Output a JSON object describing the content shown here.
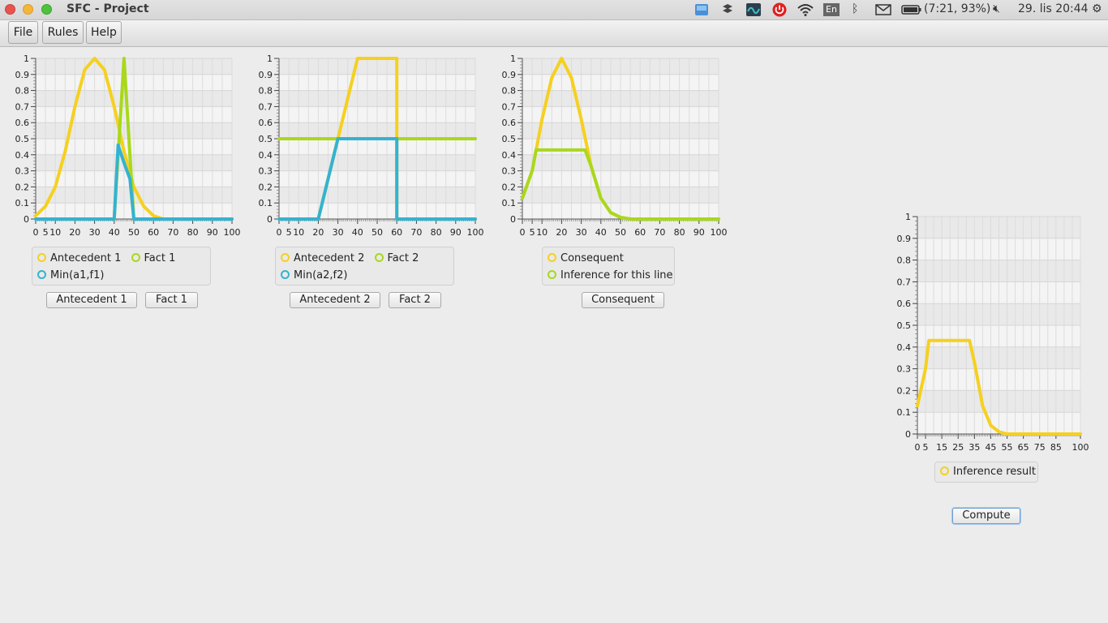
{
  "window": {
    "title": "SFC - Project"
  },
  "tray": {
    "battery": "(7:21, 93%)",
    "keyboard": "En",
    "datetime": "29. lis 20:44",
    "icons": [
      "dropbox-icon",
      "network-indicator-icon",
      "power-icon",
      "wifi-icon",
      "keyboard-layout-icon",
      "bluetooth-icon",
      "mail-icon",
      "battery-icon",
      "volume-muted-icon",
      "settings-gear-icon"
    ]
  },
  "menu": {
    "file": "File",
    "rules": "Rules",
    "help": "Help"
  },
  "colors": {
    "yellow": "#f5d020",
    "green": "#a9d81c",
    "blue": "#34b3d0"
  },
  "charts": {
    "c1": {
      "legend_line1": [
        "Antecedent 1",
        "Fact 1"
      ],
      "legend_line2": [
        "Min(a1,f1)"
      ],
      "buttons": [
        "Antecedent 1",
        "Fact 1"
      ]
    },
    "c2": {
      "legend_line1": [
        "Antecedent 2",
        "Fact 2"
      ],
      "legend_line2": [
        "Min(a2,f2)"
      ],
      "buttons": [
        "Antecedent 2",
        "Fact 2"
      ]
    },
    "c3": {
      "legend_line1": [
        "Consequent"
      ],
      "legend_line2": [
        "Inference for this line"
      ],
      "buttons": [
        "Consequent"
      ]
    },
    "c4": {
      "legend_line1": [
        "Inference result"
      ],
      "buttons": [
        "Compute"
      ]
    }
  },
  "chart_data": [
    {
      "type": "line",
      "xlim": [
        0,
        100
      ],
      "ylim": [
        0,
        1
      ],
      "xticks": [
        "0",
        "5",
        "10",
        "20",
        "30",
        "40",
        "50",
        "60",
        "70",
        "80",
        "90",
        "100"
      ],
      "yticks": [
        "0",
        "0.1",
        "0.2",
        "0.3",
        "0.4",
        "0.5",
        "0.6",
        "0.7",
        "0.8",
        "0.9",
        "1"
      ],
      "series": [
        {
          "name": "Antecedent 1",
          "color": "yellow",
          "x": [
            0,
            5,
            10,
            15,
            20,
            25,
            30,
            35,
            40,
            45,
            50,
            55,
            60,
            65,
            70,
            100
          ],
          "y": [
            0.02,
            0.08,
            0.2,
            0.42,
            0.7,
            0.93,
            1.0,
            0.93,
            0.7,
            0.42,
            0.2,
            0.08,
            0.02,
            0.0,
            0.0,
            0.0
          ]
        },
        {
          "name": "Fact 1",
          "color": "green",
          "x": [
            0,
            40,
            45,
            50,
            100
          ],
          "y": [
            0,
            0,
            1,
            0,
            0
          ]
        },
        {
          "name": "Min(a1,f1)",
          "color": "blue",
          "x": [
            0,
            40,
            42,
            45,
            48,
            50,
            100
          ],
          "y": [
            0,
            0,
            0.46,
            0.35,
            0.25,
            0,
            0
          ]
        }
      ]
    },
    {
      "type": "line",
      "xlim": [
        0,
        100
      ],
      "ylim": [
        0,
        1
      ],
      "xticks": [
        "0",
        "5",
        "10",
        "20",
        "30",
        "40",
        "50",
        "60",
        "70",
        "80",
        "90",
        "100"
      ],
      "yticks": [
        "0",
        "0.1",
        "0.2",
        "0.3",
        "0.4",
        "0.5",
        "0.6",
        "0.7",
        "0.8",
        "0.9",
        "1"
      ],
      "series": [
        {
          "name": "Antecedent 2",
          "color": "yellow",
          "x": [
            0,
            20,
            40,
            60,
            60,
            100
          ],
          "y": [
            0,
            0,
            1,
            1,
            0,
            0
          ]
        },
        {
          "name": "Fact 2",
          "color": "green",
          "x": [
            0,
            100
          ],
          "y": [
            0.5,
            0.5
          ]
        },
        {
          "name": "Min(a2,f2)",
          "color": "blue",
          "x": [
            0,
            20,
            30,
            60,
            60,
            100
          ],
          "y": [
            0,
            0,
            0.5,
            0.5,
            0,
            0
          ]
        }
      ]
    },
    {
      "type": "line",
      "xlim": [
        0,
        100
      ],
      "ylim": [
        0,
        1
      ],
      "xticks": [
        "0",
        "5",
        "10",
        "20",
        "30",
        "40",
        "50",
        "60",
        "70",
        "80",
        "90",
        "100"
      ],
      "yticks": [
        "0",
        "0.1",
        "0.2",
        "0.3",
        "0.4",
        "0.5",
        "0.6",
        "0.7",
        "0.8",
        "0.9",
        "1"
      ],
      "series": [
        {
          "name": "Consequent",
          "color": "yellow",
          "x": [
            0,
            5,
            10,
            15,
            20,
            25,
            30,
            35,
            40,
            45,
            50,
            55,
            60,
            100
          ],
          "y": [
            0.13,
            0.3,
            0.62,
            0.88,
            1.0,
            0.88,
            0.62,
            0.33,
            0.13,
            0.04,
            0.01,
            0.0,
            0.0,
            0.0
          ]
        },
        {
          "name": "Inference for this line",
          "color": "green",
          "x": [
            0,
            5,
            7,
            32,
            35,
            40,
            45,
            50,
            55,
            60,
            100
          ],
          "y": [
            0.13,
            0.3,
            0.43,
            0.43,
            0.33,
            0.13,
            0.04,
            0.01,
            0.0,
            0.0,
            0.0
          ]
        }
      ]
    },
    {
      "type": "line",
      "xlim": [
        0,
        100
      ],
      "ylim": [
        0,
        1
      ],
      "xticks": [
        "0",
        "5",
        "15",
        "25",
        "35",
        "45",
        "55",
        "65",
        "75",
        "85",
        "100"
      ],
      "yticks": [
        "0",
        "0.1",
        "0.2",
        "0.3",
        "0.4",
        "0.5",
        "0.6",
        "0.7",
        "0.8",
        "0.9",
        "1"
      ],
      "series": [
        {
          "name": "Inference result",
          "color": "yellow",
          "x": [
            0,
            5,
            7,
            32,
            35,
            40,
            45,
            50,
            55,
            60,
            100
          ],
          "y": [
            0.13,
            0.3,
            0.43,
            0.43,
            0.33,
            0.13,
            0.04,
            0.01,
            0.0,
            0.0,
            0.0
          ]
        }
      ]
    }
  ]
}
